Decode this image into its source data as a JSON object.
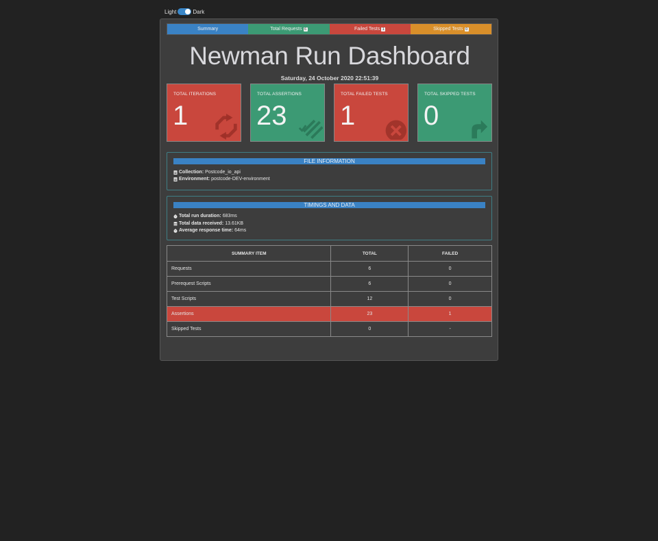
{
  "theme_toggle": {
    "light_label": "Light",
    "dark_label": "Dark",
    "state": "dark"
  },
  "tabs": [
    {
      "label": "Summary",
      "badge": null,
      "color": "#3a82c4"
    },
    {
      "label": "Total Requests",
      "badge": "6",
      "color": "#3c9a74"
    },
    {
      "label": "Failed Tests",
      "badge": "1",
      "color": "#c9473d"
    },
    {
      "label": "Skipped Tests",
      "badge": "0",
      "color": "#d98f2a"
    }
  ],
  "title": "Newman Run Dashboard",
  "date": "Saturday, 24 October 2020 22:51:39",
  "stats": [
    {
      "label": "TOTAL ITERATIONS",
      "value": "1",
      "color": "#c9473d",
      "icon": "refresh-icon"
    },
    {
      "label": "TOTAL ASSERTIONS",
      "value": "23",
      "color": "#3c9a74",
      "icon": "checklist-icon"
    },
    {
      "label": "TOTAL FAILED TESTS",
      "value": "1",
      "color": "#c9473d",
      "icon": "error-circle-icon"
    },
    {
      "label": "TOTAL SKIPPED TESTS",
      "value": "0",
      "color": "#3c9a74",
      "icon": "share-arrow-icon"
    }
  ],
  "file_info": {
    "heading": "FILE INFORMATION",
    "collection_label": "Collection:",
    "collection_value": "Postcode_io_api",
    "environment_label": "Environment:",
    "environment_value": "postcode-DEV-environment"
  },
  "timings": {
    "heading": "TIMINGS AND DATA",
    "duration_label": "Total run duration:",
    "duration_value": "683ms",
    "data_label": "Total data received:",
    "data_value": "13.61KB",
    "avg_label": "Average response time:",
    "avg_value": "64ms"
  },
  "summary_table": {
    "headers": [
      "SUMMARY ITEM",
      "TOTAL",
      "FAILED"
    ],
    "rows": [
      {
        "item": "Requests",
        "total": "6",
        "failed": "0",
        "highlight": false
      },
      {
        "item": "Prerequest Scripts",
        "total": "6",
        "failed": "0",
        "highlight": false
      },
      {
        "item": "Test Scripts",
        "total": "12",
        "failed": "0",
        "highlight": false
      },
      {
        "item": "Assertions",
        "total": "23",
        "failed": "1",
        "highlight": true
      },
      {
        "item": "Skipped Tests",
        "total": "0",
        "failed": "-",
        "highlight": false
      }
    ]
  }
}
